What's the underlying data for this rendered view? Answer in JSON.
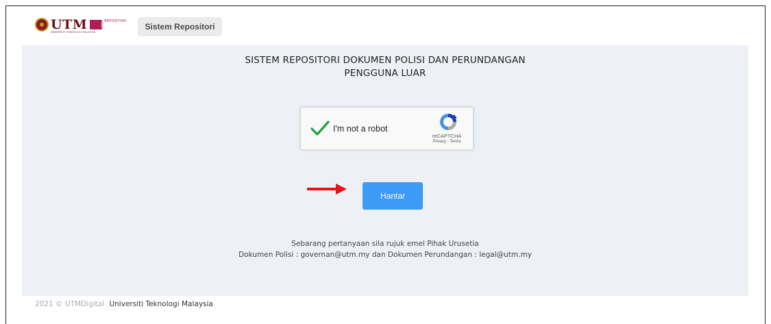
{
  "header": {
    "logo_text": "UTM",
    "logo_subtext": "UNIVERSITI TEKNOLOGI MALAYSIA",
    "logo_repo_text": "REPOSITORI",
    "nav_button_label": "Sistem Repositori"
  },
  "main": {
    "title_line1": "SISTEM REPOSITORI DOKUMEN POLISI DAN PERUNDANGAN",
    "title_line2": "PENGGUNA LUAR",
    "recaptcha": {
      "label": "I'm not a robot",
      "brand": "reCAPTCHA",
      "links": "Privacy - Terms",
      "checked": true
    },
    "submit_label": "Hantar",
    "contact_line1": "Sebarang pertanyaan sila rujuk emel Pihak Urusetia",
    "contact_line2": "Dokumen Polisi : governan@utm.my dan Dokumen Perundangan : legal@utm.my"
  },
  "footer": {
    "copyright": "2021 © UTMDigital",
    "organization": "Universiti Teknologi Malaysia"
  },
  "colors": {
    "panel_bg": "#edf0f5",
    "submit_bg": "#3d9af5",
    "check_green": "#1e9e3e",
    "annotation_arrow": "#e8141b",
    "logo_maroon": "#6b0f1a"
  }
}
